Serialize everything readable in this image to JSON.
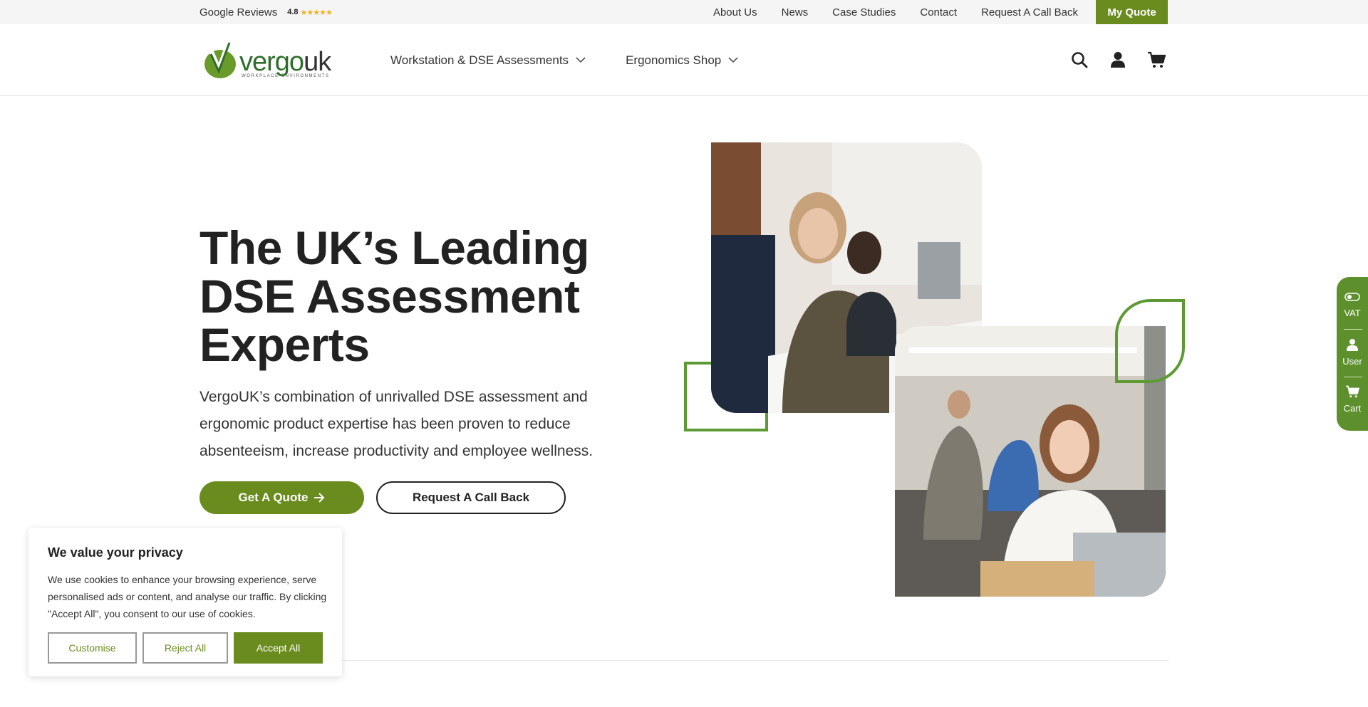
{
  "topbar": {
    "reviews_label": "Google Reviews",
    "rating": "4.8",
    "stars": "★★★★★",
    "links": [
      "About Us",
      "News",
      "Case Studies",
      "Contact",
      "Request A Call Back"
    ],
    "my_quote": "My Quote"
  },
  "header": {
    "logo_text_main": "vergo",
    "logo_text_uk": "uk",
    "logo_tagline": "WORKPLACE ENVIRONMENTS",
    "nav": [
      "Workstation & DSE Assessments",
      "Ergonomics Shop"
    ]
  },
  "hero": {
    "title_line1": "The UK’s Leading",
    "title_line2": "DSE Assessment",
    "title_line3": "Experts",
    "description": "VergoUK’s combination of unrivalled DSE assessment and ergonomic product expertise has been proven to reduce absenteeism, increase productivity and employee wellness.",
    "cta_primary": "Get A Quote",
    "cta_secondary": "Request A Call Back"
  },
  "sidetab": {
    "vat": "VAT",
    "user": "User",
    "cart": "Cart"
  },
  "cookie": {
    "title": "We value your privacy",
    "text": "We use cookies to enhance your browsing experience, serve personalised ads or content, and analyse our traffic. By clicking \"Accept All\", you consent to our use of cookies.",
    "customise": "Customise",
    "reject": "Reject All",
    "accept": "Accept All"
  },
  "colors": {
    "brand_green": "#6a8c1f",
    "leaf_green": "#5d9a34",
    "star": "#f2b01e"
  }
}
